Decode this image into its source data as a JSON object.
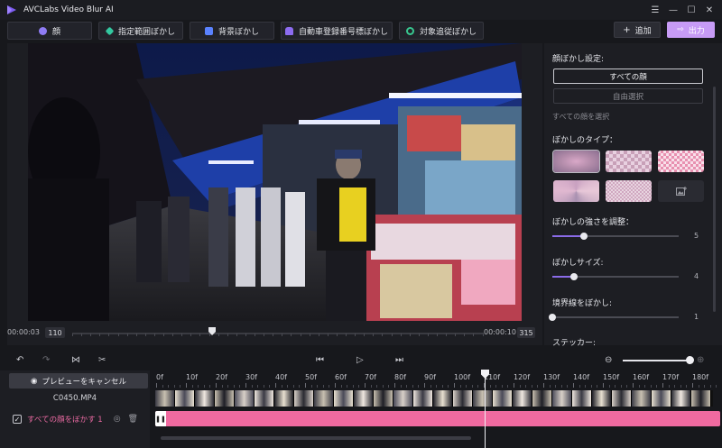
{
  "app": {
    "title": "AVCLabs Video Blur AI",
    "accent_color": "#c79bf5",
    "track_color": "#f06aa0"
  },
  "window_controls": [
    "menu-icon",
    "minimize-icon",
    "maximize-icon",
    "close-icon"
  ],
  "toolbar": {
    "buttons": [
      {
        "label": "顔",
        "icon": "face-icon",
        "icon_color": "#8f7cf5"
      },
      {
        "label": "指定範囲ぼかし",
        "icon": "crosshair-icon",
        "icon_color": "#33c8a0"
      },
      {
        "label": "背景ぼかし",
        "icon": "background-icon",
        "icon_color": "#5a82ff"
      },
      {
        "label": "自動車登録番号標ぼかし",
        "icon": "car-icon",
        "icon_color": "#8d6cf0"
      },
      {
        "label": "対象追従ぼかし",
        "icon": "target-icon",
        "icon_color": "#38c890"
      }
    ],
    "add_label": "追加",
    "export_label": "出力"
  },
  "preview": {
    "start_time": "00:00:03",
    "start_frame": "110",
    "end_time": "00:00:10",
    "end_frame": "315",
    "playhead_fraction": 0.34
  },
  "panel": {
    "face_blur_title": "顔ぼかし設定:",
    "all_faces_label": "すべての顔",
    "free_select_label": "自由選択",
    "all_faces_hint": "すべての顔を選択",
    "blur_type_title": "ぼかしのタイプ：",
    "blur_types": [
      "gaussian",
      "mosaic-coarse",
      "mosaic-color",
      "swirl",
      "mosaic-fine",
      "custom-image"
    ],
    "selected_blur_type": 0,
    "strength_title": "ぼかしの強さを調整：",
    "strength_value": "5",
    "strength_fraction": 0.25,
    "size_title": "ぼかしサイズ:",
    "size_value": "4",
    "size_fraction": 0.17,
    "edge_title": "境界線をぼかし:",
    "edge_value": "1",
    "edge_fraction": 0.0,
    "sticker_title": "ステッカー:"
  },
  "timeline": {
    "cancel_preview_label": "プレビューをキャンセル",
    "clip_name": "C0450.MP4",
    "layer_name": "すべての顔をぼかす 1",
    "ruler_labels": [
      "0f",
      "10f",
      "20f",
      "30f",
      "40f",
      "50f",
      "60f",
      "70f",
      "80f",
      "90f",
      "100f",
      "110f",
      "120f",
      "130f",
      "140f",
      "150f",
      "160f",
      "170f",
      "180f"
    ],
    "playhead_frame": 110,
    "zoom_fraction": 0.95
  }
}
